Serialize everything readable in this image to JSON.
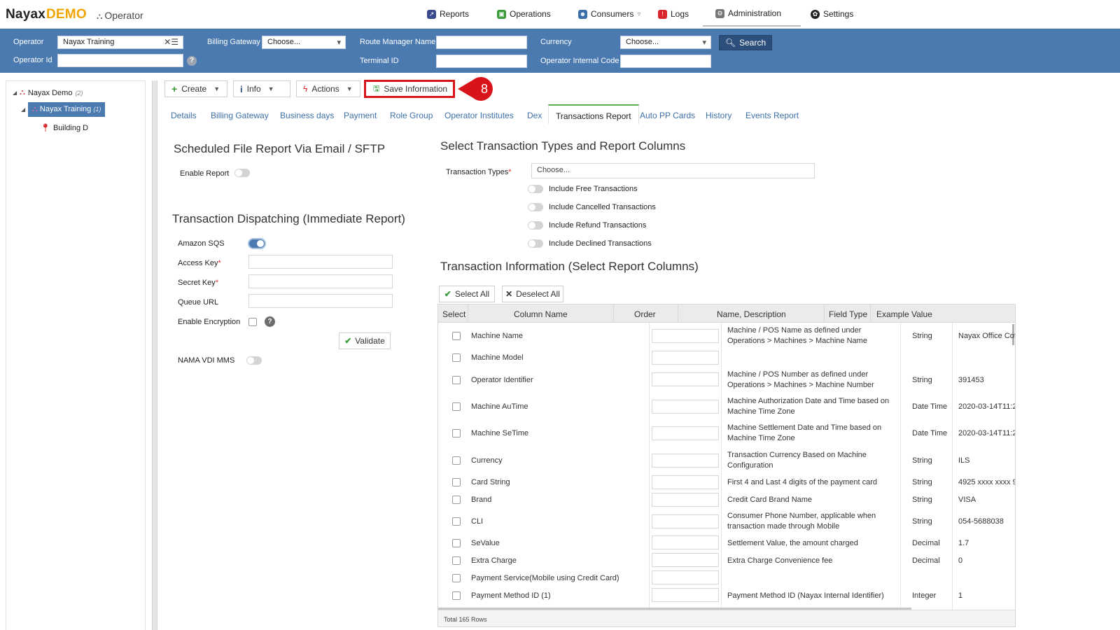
{
  "brand": {
    "name": "Nayax",
    "demo": "DEMO",
    "section": "Operator"
  },
  "topnav": {
    "items": [
      {
        "label": "Reports",
        "icon": "reports-icon",
        "color": "#3b4a8c"
      },
      {
        "label": "Operations",
        "icon": "operations-icon",
        "color": "#3a9a3a"
      },
      {
        "label": "Consumers",
        "icon": "consumers-icon",
        "color": "#3c6fa8"
      },
      {
        "label": "Logs",
        "icon": "logs-icon",
        "color": "#d9262c"
      },
      {
        "label": "Administration",
        "icon": "administration-icon",
        "color": "#777777"
      },
      {
        "label": "Settings",
        "icon": "settings-icon",
        "color": "#222222"
      }
    ]
  },
  "filters": {
    "operator_label": "Operator",
    "operator_value": "Nayax Training",
    "operator_id_label": "Operator Id",
    "billing_gateway_label": "Billing Gateway",
    "billing_gateway_value": "Choose...",
    "route_manager_label": "Route Manager Name",
    "terminal_id_label": "Terminal ID",
    "currency_label": "Currency",
    "currency_value": "Choose...",
    "internal_code_label": "Operator Internal Code",
    "search_label": "Search"
  },
  "tree": {
    "root": {
      "label": "Nayax Demo",
      "count": "(2)"
    },
    "selected": {
      "label": "Nayax Training",
      "count": "(1)"
    },
    "child": {
      "label": "Building D"
    }
  },
  "toolbar": {
    "create": "Create",
    "info": "Info",
    "actions": "Actions",
    "save": "Save Information",
    "callout_number": "8"
  },
  "tabs": [
    "Details",
    "Billing Gateway",
    "Business days",
    "Payment",
    "Role Group",
    "Operator Institutes",
    "Dex",
    "Transactions Report",
    "Auto PP Cards",
    "History",
    "Events Report"
  ],
  "scheduled": {
    "title": "Scheduled File Report Via Email / SFTP",
    "enable_report": "Enable Report"
  },
  "dispatch": {
    "title": "Transaction Dispatching (Immediate Report)",
    "amazon_sqs": "Amazon SQS",
    "access_key": "Access Key",
    "secret_key": "Secret Key",
    "queue_url": "Queue URL",
    "enable_encryption": "Enable Encryption",
    "validate": "Validate",
    "nama": "NAMA VDI MMS"
  },
  "txtypes": {
    "title": "Select Transaction Types and Report Columns",
    "types_label": "Transaction Types",
    "types_placeholder": "Choose...",
    "include_free": "Include Free Transactions",
    "include_cancelled": "Include Cancelled Transactions",
    "include_refund": "Include Refund Transactions",
    "include_declined": "Include Declined Transactions"
  },
  "txinfo": {
    "title": "Transaction Information (Select Report Columns)",
    "select_all": "Select All",
    "deselect_all": "Deselect All",
    "columns": [
      "Select",
      "Column Name",
      "Order",
      "Name, Description",
      "Field Type",
      "Example Value"
    ],
    "rows": [
      {
        "name": "Machine Name",
        "desc": "Machine / POS Name as defined under Operations > Machines > Machine Name",
        "type": "String",
        "example": "Nayax Office Cof"
      },
      {
        "name": "Machine Model",
        "desc": "",
        "type": "",
        "example": ""
      },
      {
        "name": "Operator Identifier",
        "desc": "Machine / POS Number as defined under Operations > Machines > Machine Number",
        "type": "String",
        "example": "391453"
      },
      {
        "name": "Machine AuTime",
        "desc": "Machine Authorization Date and Time based on Machine Time Zone",
        "type": "Date Time",
        "example": "2020-03-14T11:2"
      },
      {
        "name": "Machine SeTime",
        "desc": "Machine Settlement Date and Time based on Machine Time Zone",
        "type": "Date Time",
        "example": "2020-03-14T11:2"
      },
      {
        "name": "Currency",
        "desc": "Transaction Currency Based on Machine Configuration",
        "type": "String",
        "example": "ILS"
      },
      {
        "name": "Card String",
        "desc": "First 4 and Last 4 digits of the payment card",
        "type": "String",
        "example": "4925 xxxx xxxx 9!"
      },
      {
        "name": "Brand",
        "desc": "Credit Card Brand Name",
        "type": "String",
        "example": "VISA"
      },
      {
        "name": "CLI",
        "desc": "Consumer Phone Number, applicable when transaction made through Mobile",
        "type": "String",
        "example": "054-5688038"
      },
      {
        "name": "SeValue",
        "desc": "Settlement Value, the amount charged",
        "type": "Decimal",
        "example": "1.7"
      },
      {
        "name": "Extra Charge",
        "desc": "Extra Charge Convenience fee",
        "type": "Decimal",
        "example": "0"
      },
      {
        "name": "Payment Service(Mobile using Credit Card)",
        "desc": "",
        "type": "",
        "example": ""
      },
      {
        "name": "Payment Method ID (1)",
        "desc": "Payment Method ID (Nayax Internal Identifier)",
        "type": "Integer",
        "example": "1"
      }
    ],
    "footer": "Total 165 Rows"
  }
}
